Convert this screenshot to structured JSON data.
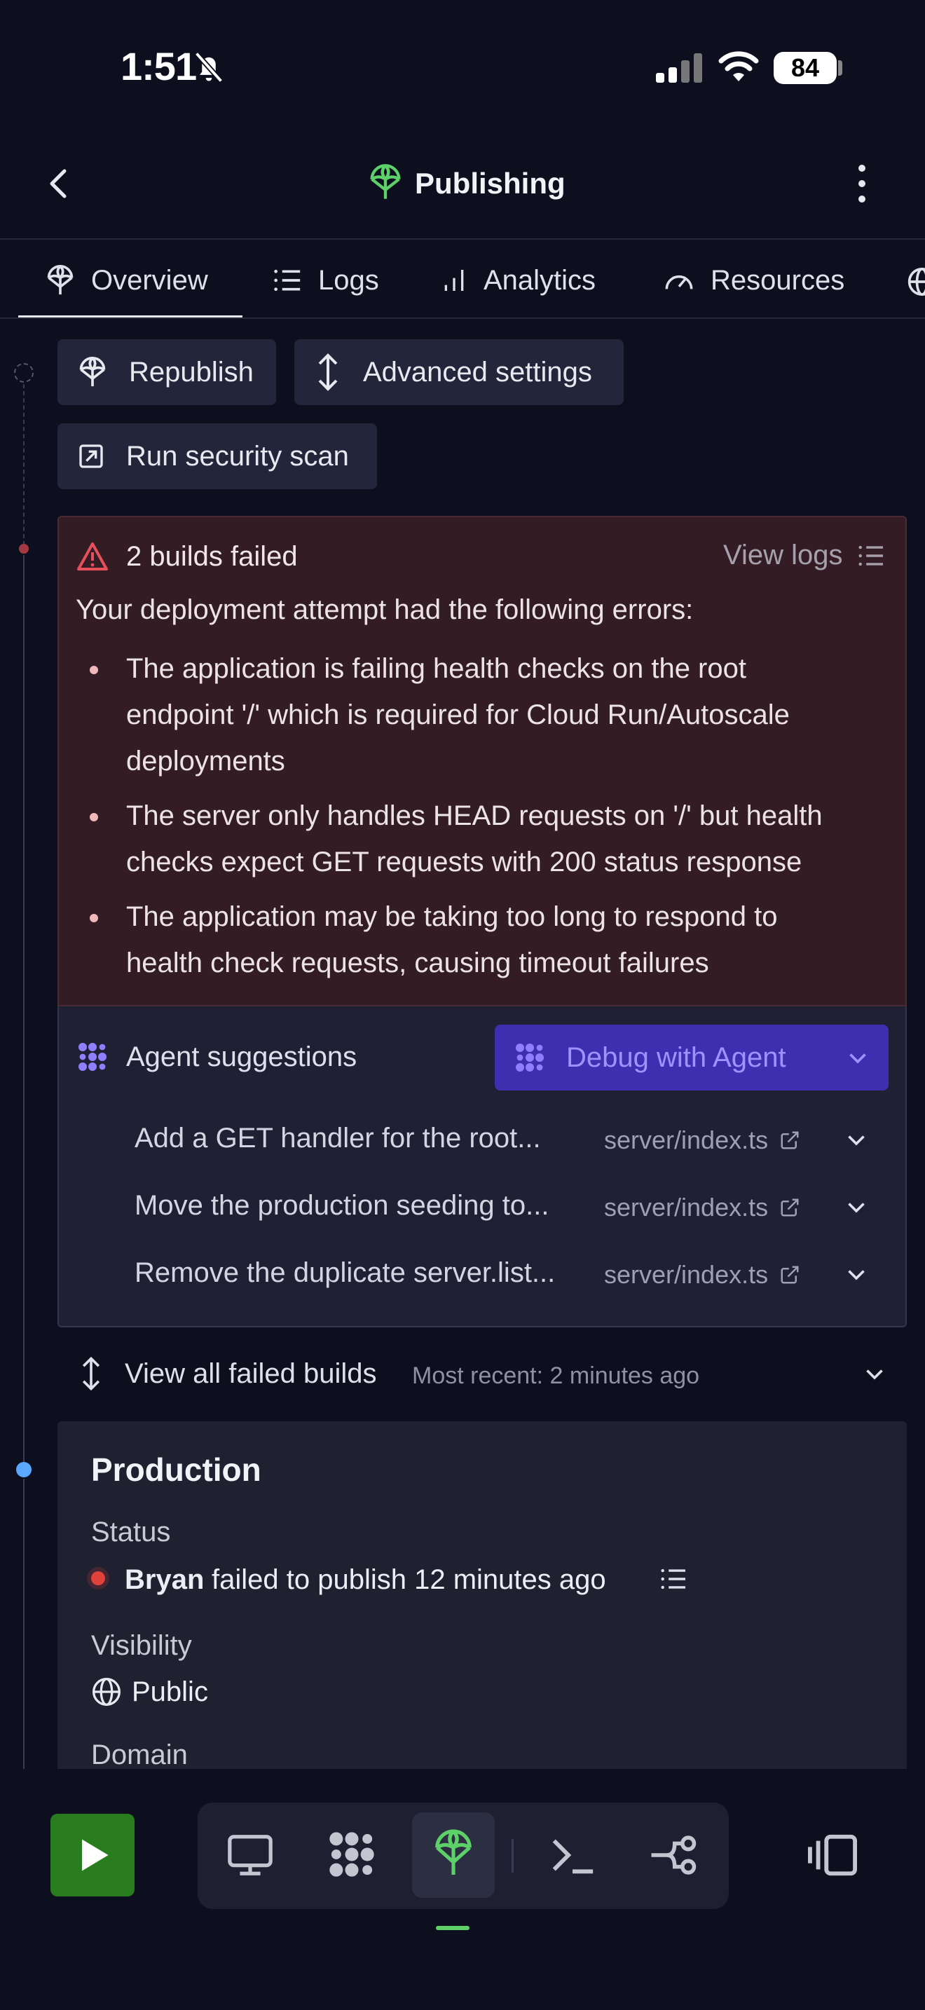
{
  "status_bar": {
    "time": "1:51",
    "battery": "84"
  },
  "header": {
    "title": "Publishing"
  },
  "tabs": [
    {
      "label": "Overview"
    },
    {
      "label": "Logs"
    },
    {
      "label": "Analytics"
    },
    {
      "label": "Resources"
    }
  ],
  "actions": {
    "republish": "Republish",
    "advanced_settings": "Advanced settings",
    "run_security_scan": "Run security scan"
  },
  "error": {
    "title": "2 builds failed",
    "view_logs": "View logs",
    "intro": "Your deployment attempt had the following errors:",
    "items": [
      {
        "lines": [
          "The application is failing health checks on the root",
          "endpoint '/' which is required for Cloud Run/Autoscale",
          "deployments"
        ]
      },
      {
        "lines": [
          "The server only handles HEAD requests on '/' but health",
          "checks expect GET requests with 200 status response"
        ]
      },
      {
        "lines": [
          "The application may be taking too long to respond to",
          "health check requests, causing timeout failures"
        ]
      }
    ]
  },
  "suggestions": {
    "title": "Agent suggestions",
    "debug_button": "Debug with Agent",
    "items": [
      {
        "text": "Add a GET handler for the root...",
        "file": "server/index.ts"
      },
      {
        "text": "Move the production seeding to...",
        "file": "server/index.ts"
      },
      {
        "text": "Remove the duplicate server.list...",
        "file": "server/index.ts"
      }
    ]
  },
  "failed_builds": {
    "label": "View all failed builds",
    "recent": "Most recent: 2 minutes ago"
  },
  "production": {
    "title": "Production",
    "status_label": "Status",
    "status_user": "Bryan",
    "status_text": "failed to publish 12 minutes ago",
    "visibility_label": "Visibility",
    "visibility_value": "Public",
    "domain_label": "Domain"
  },
  "colors": {
    "accent_green": "#5ed06a",
    "error_bg": "#341c24",
    "agent_purple": "#9d93ff",
    "debug_btn": "#3d2fb0",
    "status_failed": "#e0413a",
    "timeline_blue": "#5aa8ff"
  }
}
